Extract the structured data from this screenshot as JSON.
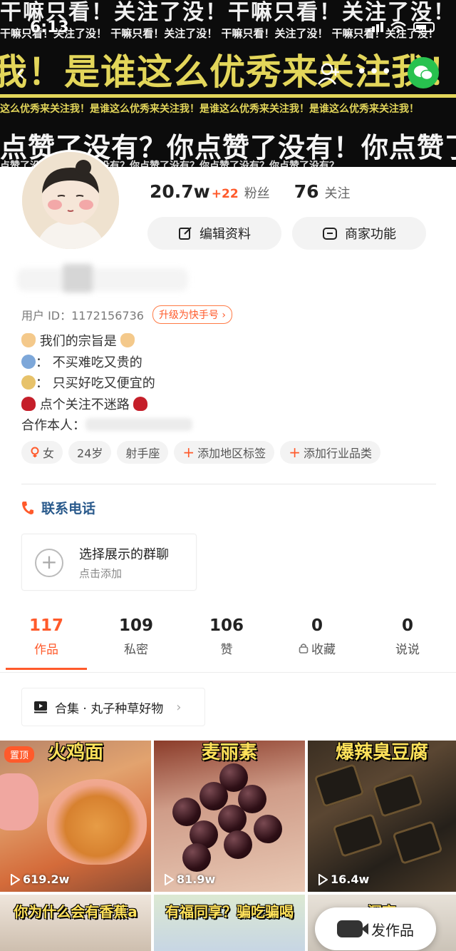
{
  "status_bar": {
    "time": "6:13"
  },
  "banner": {
    "row1": "干嘛只看！关注了没！干嘛只看！关注了没！干嘛只看！关注了没！",
    "row2": "干嘛只看！关注了没！ 干嘛只看！关注了没！ 干嘛只看！关注了没！ 干嘛只看！关注了没！",
    "row3": "我！是谁这么优秀来关注我！",
    "row4": "这么优秀来关注我！是谁这么优秀来关注我！是谁这么优秀来关注我！是谁这么优秀来关注我！",
    "row5": "点赞了没有？你点赞了没有！你点赞了",
    "row6": "点赞了没有？你点赞了没有？你点赞了没有？你点赞了没有？你点赞了没有？"
  },
  "profile": {
    "fans_num": "20.7w",
    "fans_plus": "+22",
    "fans_label": "粉丝",
    "follow_num": "76",
    "follow_label": "关注",
    "edit_label": "编辑资料",
    "biz_label": "商家功能",
    "uid_label": "用户 ID：1172156736",
    "upgrade_label": "升级为快手号 ›",
    "bio_line1": "我们的宗旨是",
    "bio_line2": "：  不买难吃又贵的",
    "bio_line3": "：   只买好吃又便宜的",
    "bio_line4": "点个关注不迷路",
    "coop_label": "合作本人：",
    "tags": [
      "女",
      "24岁",
      "射手座"
    ],
    "tag_add_region": "添加地区标签",
    "tag_add_industry": "添加行业品类",
    "phone_label": "联系电话",
    "group_title": "选择展示的群聊",
    "group_sub": "点击添加"
  },
  "tabs": [
    {
      "num": "117",
      "label": "作品"
    },
    {
      "num": "109",
      "label": "私密"
    },
    {
      "num": "106",
      "label": "赞"
    },
    {
      "num": "0",
      "label": "收藏"
    },
    {
      "num": "0",
      "label": "说说"
    }
  ],
  "collection_label": "合集 · 丸子种草好物",
  "grid": [
    {
      "title": "火鸡面",
      "views": "619.2w",
      "pinned": "置顶"
    },
    {
      "title": "麦丽素",
      "views": "81.9w"
    },
    {
      "title": "爆辣臭豆腐",
      "views": "16.4w"
    },
    {
      "title": "你为什么会有香蕉a"
    },
    {
      "title": "有福同享？骗吃骗喝"
    },
    {
      "title": "深夜"
    }
  ],
  "publish_label": "发作品",
  "colors": {
    "accent": "#ff5a2b",
    "banner_yellow": "#e3d65a",
    "phone_blue": "#2a5a8c",
    "wechat_green": "#28c24f"
  }
}
